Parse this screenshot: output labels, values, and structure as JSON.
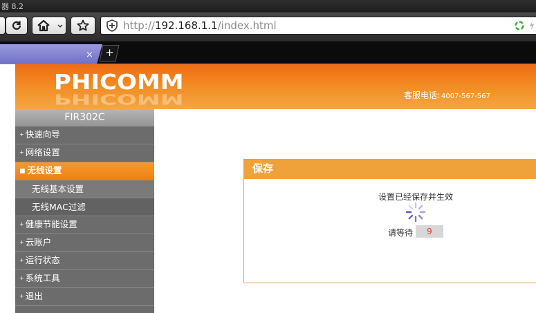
{
  "window": {
    "title": "器 8.2"
  },
  "toolbar": {
    "url_protocol": "http://",
    "url_host": "192.168.1.1",
    "url_path": "/index.html"
  },
  "tabs": {
    "close_glyph": "×",
    "new_tab_glyph": "+"
  },
  "header": {
    "logo": "PHICOMM",
    "hotline_label": "客服电话:",
    "hotline_number": "4007-567-567"
  },
  "sidebar": {
    "model": "FIR302C",
    "items": [
      {
        "label": "快速向导",
        "bullet": "+"
      },
      {
        "label": "网络设置",
        "bullet": "+"
      },
      {
        "label": "无线设置",
        "bullet": "■",
        "active": true
      },
      {
        "label": "无线基本设置",
        "sub": true
      },
      {
        "label": "无线MAC过滤",
        "sub": true
      },
      {
        "label": "健康节能设置",
        "bullet": "+"
      },
      {
        "label": "云账户",
        "bullet": "+"
      },
      {
        "label": "运行状态",
        "bullet": "+"
      },
      {
        "label": "系统工具",
        "bullet": "+"
      },
      {
        "label": "退出",
        "bullet": "+"
      }
    ]
  },
  "panel": {
    "title": "保存",
    "message": "设置已经保存并生效",
    "wait_label": "请等待",
    "countdown": "9"
  },
  "colors": {
    "header_orange": "#f28a22",
    "panel_orange": "#f0a23a",
    "countdown_red": "#e63a2a",
    "sidebar_gray": "#6b6b6b"
  }
}
